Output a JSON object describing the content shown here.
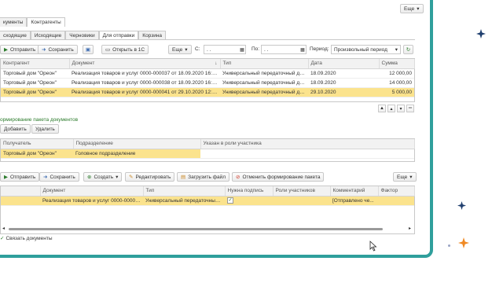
{
  "window": {
    "more_label": "Еще",
    "tabs": [
      "кументы",
      "Контрагенты"
    ]
  },
  "subtabs": [
    "сходящие",
    "Исходящие",
    "Черновики",
    "Для отправки",
    "Корзина"
  ],
  "toolbar": {
    "send": "Отправить",
    "save": "Сохранить",
    "open_1c": "Открыть в 1С",
    "more": "Еще",
    "from_label": "С:",
    "from_value": ". .",
    "to_label": "По:",
    "to_value": ". .",
    "period_label": "Период:",
    "period_value": "Произвольный период"
  },
  "docs_table": {
    "columns": [
      "Контрагент",
      "Документ",
      "Тип",
      "Дата",
      "Сумма"
    ],
    "rows": [
      {
        "counterparty": "Торговый дом \"Ореон\"",
        "document": "Реализация товаров и услуг 0000-000037 от 18.09.2020 16:09:12",
        "type": "Универсальный передаточный до...",
        "date": "18.09.2020",
        "sum": "12 000,00"
      },
      {
        "counterparty": "Торговый дом \"Ореон\"",
        "document": "Реализация товаров и услуг 0000-000038 от 18.09.2020 16:10:25",
        "type": "Универсальный передаточный до...",
        "date": "18.09.2020",
        "sum": "14 000,00"
      },
      {
        "counterparty": "Торговый дом \"Ореон\"",
        "document": "Реализация товаров и услуг 0000-000041 от 29.10.2020 12:34:40",
        "type": "Универсальный передаточный до...",
        "date": "29.10.2020",
        "sum": "5 000,00"
      }
    ]
  },
  "package": {
    "title": "ормирование пакета документов",
    "add": "Добавить",
    "delete": "Удалить",
    "columns": [
      "Получатель",
      "Подразделение",
      "Указан в роли участника"
    ],
    "row": {
      "recipient": "Торговый дом \"Ореон\"",
      "department": "Головное подразделение",
      "role": ""
    }
  },
  "bottom_toolbar": {
    "send": "Отправить",
    "save": "Сохранить",
    "create": "Создать",
    "edit": "Редактировать",
    "upload": "Загрузить файл",
    "cancel_package": "Отменить формирование пакета",
    "more": "Еще"
  },
  "bottom_table": {
    "columns": [
      "Документ",
      "Тип",
      "Нужна подпись",
      "Роли участников",
      "Комментарий",
      "Фактор"
    ],
    "row": {
      "document": "Реализация товаров и услуг 0000-00004...",
      "type": "Универсальный передаточный ...",
      "sign": "✓",
      "roles": "",
      "comment": "[Отправлено че...",
      "factor": ""
    }
  },
  "footer": {
    "link_docs": "Связать документы"
  },
  "colors": {
    "accent_teal": "#2f9f9c",
    "selected_row": "#fbe38d",
    "section_green": "#2a7a2a",
    "star_navy": "#1f3f6e",
    "star_orange": "#f08a24"
  }
}
